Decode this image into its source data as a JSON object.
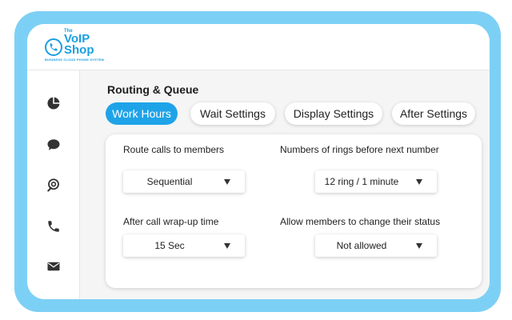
{
  "brand": {
    "the": "The",
    "voip": "VoIP",
    "shop": "Shop",
    "tagline": "BUSINESS CLOUD PHONE SYSTEM",
    "color": "#1a9fe0"
  },
  "sidebar": {
    "items": [
      {
        "icon": "pie-chart-icon"
      },
      {
        "icon": "chat-bubble-icon"
      },
      {
        "icon": "location-pin-icon"
      },
      {
        "icon": "phone-icon"
      },
      {
        "icon": "envelope-icon"
      }
    ]
  },
  "page": {
    "title": "Routing & Queue",
    "accent": "#1fa3e8"
  },
  "tabs": [
    {
      "label": "Work Hours",
      "active": true
    },
    {
      "label": "Wait Settings",
      "active": false
    },
    {
      "label": "Display Settings",
      "active": false
    },
    {
      "label": "After Settings",
      "active": false
    }
  ],
  "settings": {
    "route_calls": {
      "label": "Route calls to members",
      "value": "Sequential"
    },
    "rings": {
      "label": "Numbers of rings before next number",
      "value": "12 ring / 1 minute"
    },
    "wrapup": {
      "label": "After call wrap-up time",
      "value": "15 Sec"
    },
    "status_change": {
      "label": "Allow members to change their status",
      "value": "Not allowed"
    }
  }
}
